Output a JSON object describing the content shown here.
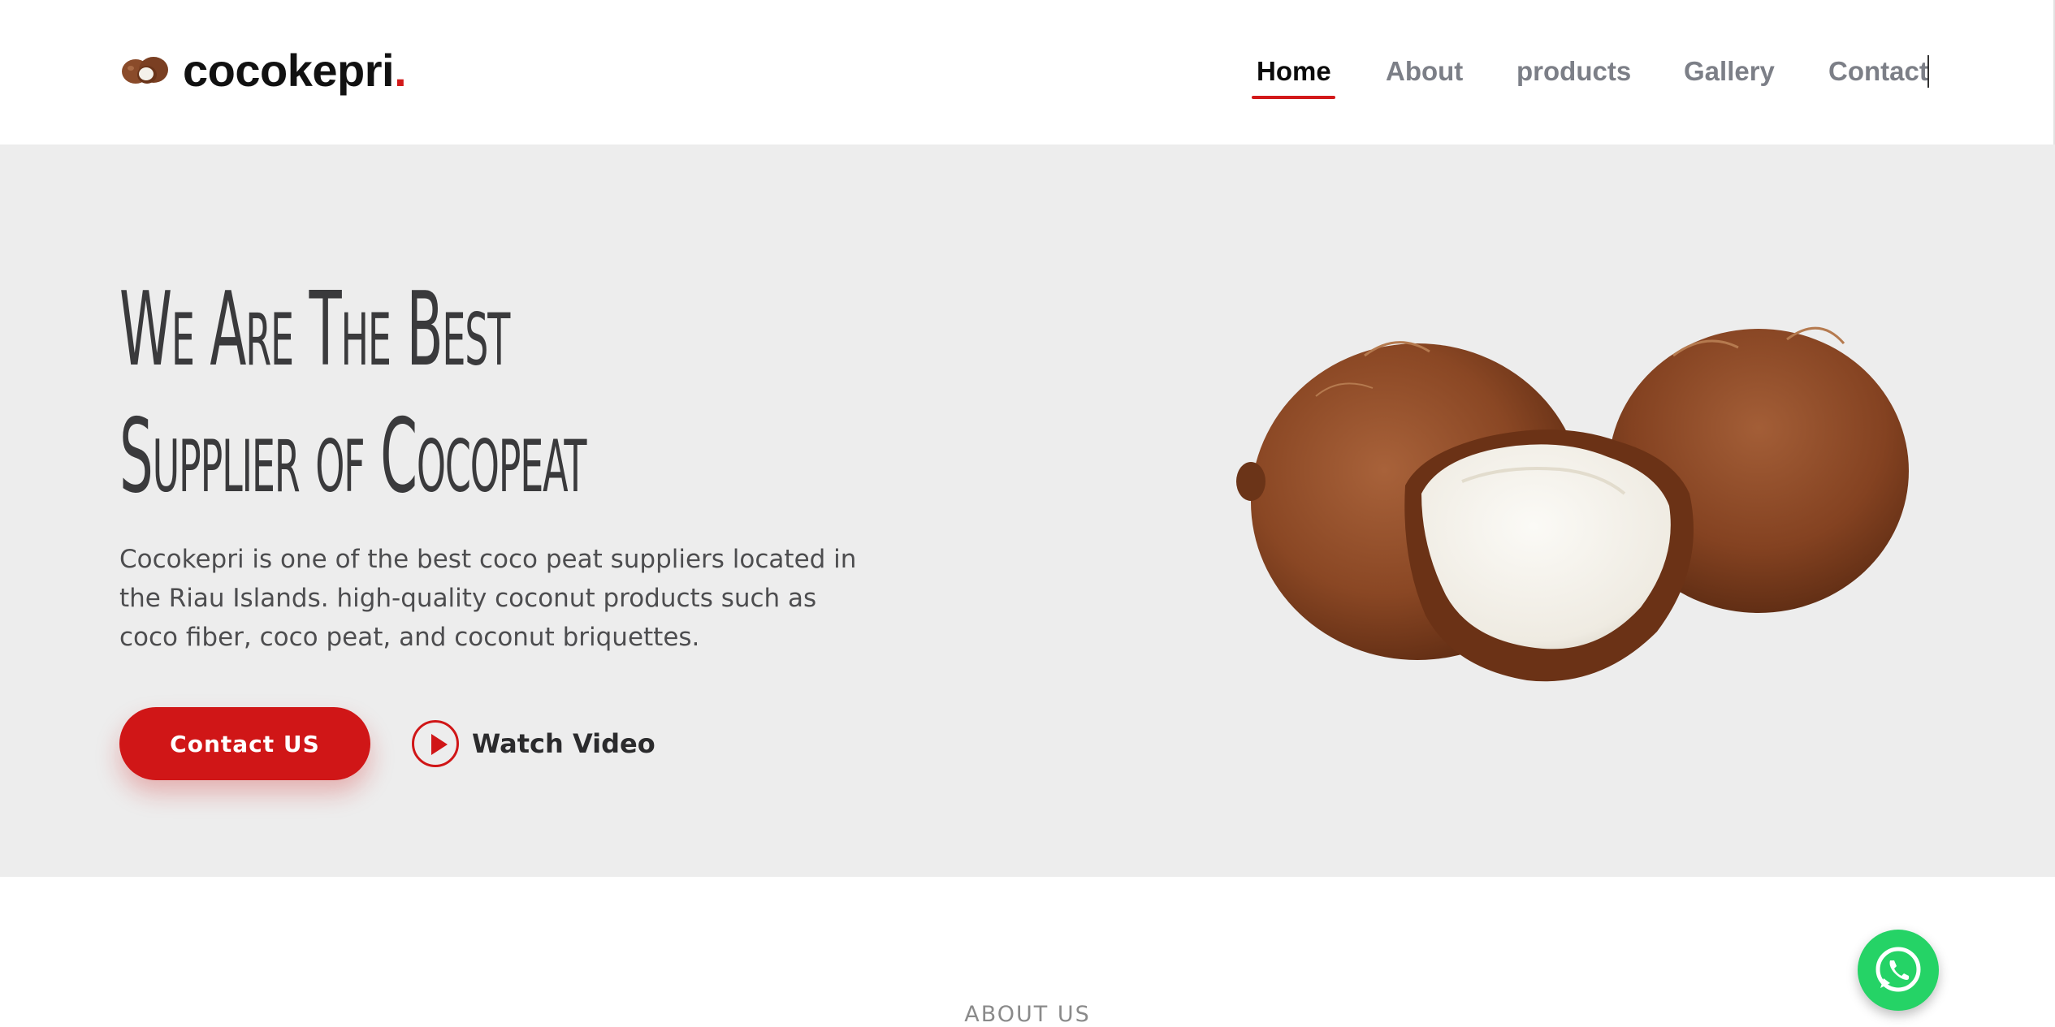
{
  "header": {
    "logo_text": "cocokepri",
    "logo_dot": ".",
    "nav": [
      {
        "label": "Home",
        "active": true
      },
      {
        "label": "About",
        "active": false
      },
      {
        "label": "products",
        "active": false
      },
      {
        "label": "Gallery",
        "active": false
      },
      {
        "label": "Contact",
        "active": false
      }
    ]
  },
  "hero": {
    "title_line1": "We Are The Best",
    "title_line2": "Supplier of Cocopeat",
    "description": "Cocokepri is one of the best coco peat suppliers located in the Riau Islands. high-quality coconut products such as coco fiber, coco peat, and coconut briquettes.",
    "contact_button": "Contact US",
    "watch_video": "Watch Video",
    "image_icon": "coconut-image"
  },
  "about": {
    "section_label": "ABOUT US"
  },
  "colors": {
    "accent": "#d01617",
    "hero_bg": "#ededed",
    "whatsapp": "#25d366"
  },
  "icons": {
    "logo": "coconut-logo-icon",
    "play": "play-icon",
    "whatsapp": "whatsapp-icon"
  }
}
